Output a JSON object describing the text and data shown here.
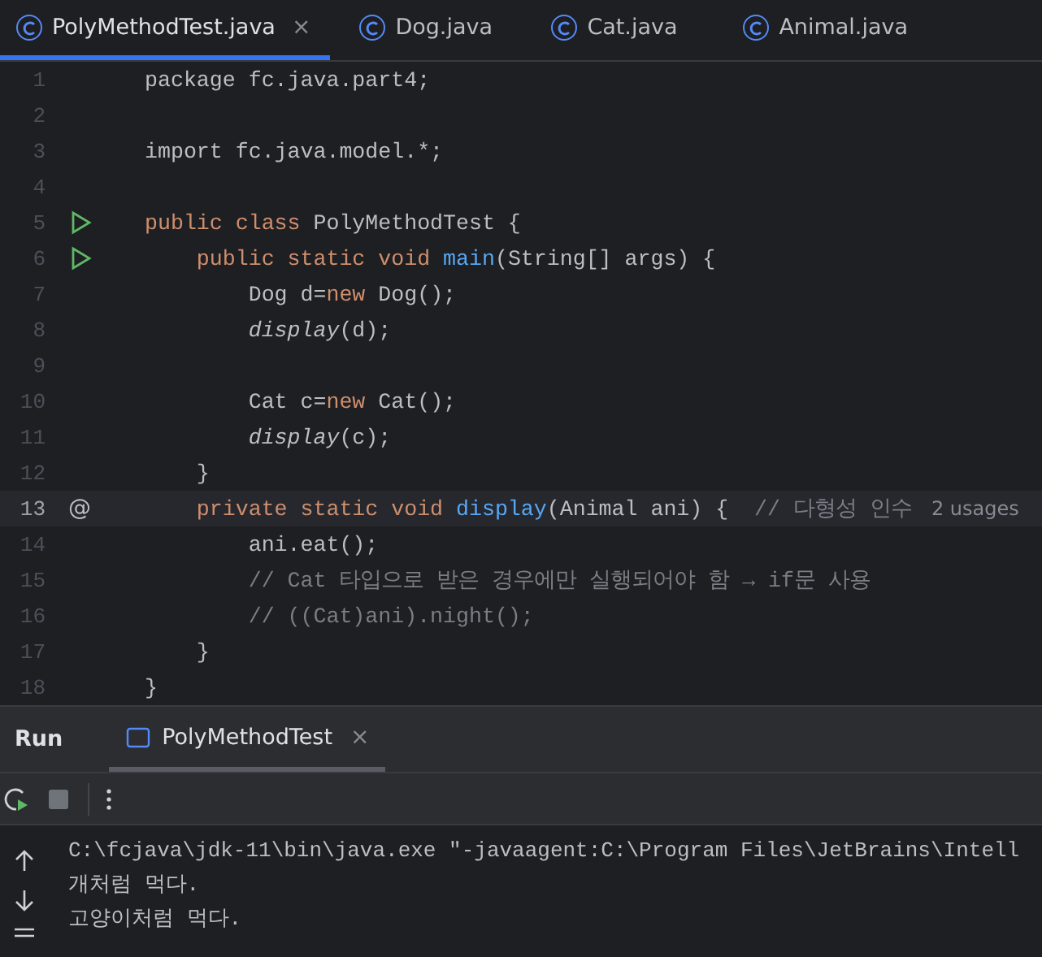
{
  "editor_tabs": [
    {
      "label": "PolyMethodTest.java",
      "selected": true,
      "close_glyph": "×"
    },
    {
      "label": "Dog.java",
      "selected": false
    },
    {
      "label": "Cat.java",
      "selected": false
    },
    {
      "label": "Animal.java",
      "selected": false
    }
  ],
  "code_lines": [
    {
      "number": "1",
      "current": false,
      "tokens": [
        {
          "text": "package fc.java.part4;",
          "kind": "plain"
        }
      ]
    },
    {
      "number": "2",
      "current": false
    },
    {
      "number": "3",
      "current": false,
      "tokens": [
        {
          "text": "import fc.java.model.*;",
          "kind": "plain"
        }
      ]
    },
    {
      "number": "4",
      "current": false
    },
    {
      "number": "5",
      "current": false,
      "gutter_icon": {
        "kind": "run"
      },
      "tokens": [
        {
          "text": "public class",
          "kind": "keyword"
        },
        {
          "text": " PolyMethodTest {",
          "kind": "plain"
        }
      ]
    },
    {
      "number": "6",
      "current": false,
      "gutter_icon": {
        "kind": "run"
      },
      "tokens": [
        {
          "text": "    public static void",
          "kind": "keyword"
        },
        {
          "text": " main",
          "kind": "function"
        },
        {
          "text": "(String[] args) {",
          "kind": "plain"
        }
      ]
    },
    {
      "number": "7",
      "current": false,
      "tokens": [
        {
          "text": "        Dog d=",
          "kind": "plain"
        },
        {
          "text": "new",
          "kind": "keyword"
        },
        {
          "text": " Dog();",
          "kind": "plain"
        }
      ]
    },
    {
      "number": "8",
      "current": false,
      "tokens": [
        {
          "text": "        display",
          "kind": "static"
        },
        {
          "text": "(d);",
          "kind": "plain"
        }
      ]
    },
    {
      "number": "9",
      "current": false
    },
    {
      "number": "10",
      "current": false,
      "tokens": [
        {
          "text": "        Cat c=",
          "kind": "plain"
        },
        {
          "text": "new",
          "kind": "keyword"
        },
        {
          "text": " Cat();",
          "kind": "plain"
        }
      ]
    },
    {
      "number": "11",
      "current": false,
      "tokens": [
        {
          "text": "        display",
          "kind": "static"
        },
        {
          "text": "(c);",
          "kind": "plain"
        }
      ]
    },
    {
      "number": "12",
      "current": false,
      "tokens": [
        {
          "text": "    }",
          "kind": "plain"
        }
      ]
    },
    {
      "number": "13",
      "current": true,
      "gutter_icon": {
        "kind": "override",
        "text": "@"
      },
      "tokens": [
        {
          "text": "    private static void",
          "kind": "keyword"
        },
        {
          "text": " display",
          "kind": "function"
        },
        {
          "text": "(Animal ani) {  ",
          "kind": "plain"
        },
        {
          "text": "// 다형성 인수",
          "kind": "comment"
        },
        {
          "text": "2 usages",
          "kind": "hint"
        }
      ]
    },
    {
      "number": "14",
      "current": false,
      "tokens": [
        {
          "text": "        ani.eat();",
          "kind": "plain"
        }
      ]
    },
    {
      "number": "15",
      "current": false,
      "tokens": [
        {
          "text": "        // Cat 타입으로 받은 경우에만 실행되어야 함 → if문 사용",
          "kind": "comment"
        }
      ]
    },
    {
      "number": "16",
      "current": false,
      "tokens": [
        {
          "text": "        // ((Cat)ani).night();",
          "kind": "comment"
        }
      ]
    },
    {
      "number": "17",
      "current": false,
      "tokens": [
        {
          "text": "    }",
          "kind": "plain"
        }
      ]
    },
    {
      "number": "18",
      "current": false,
      "tokens": [
        {
          "text": "}",
          "kind": "plain"
        }
      ]
    }
  ],
  "run_panel": {
    "title": "Run",
    "tabs": [
      {
        "label": "PolyMethodTest",
        "selected": true,
        "close_glyph": "×"
      }
    ],
    "console_lines": [
      "C:\\fcjava\\jdk-11\\bin\\java.exe \"-javaagent:C:\\Program Files\\JetBrains\\Intell",
      "개처럼 먹다.",
      "고양이처럼 먹다."
    ]
  }
}
